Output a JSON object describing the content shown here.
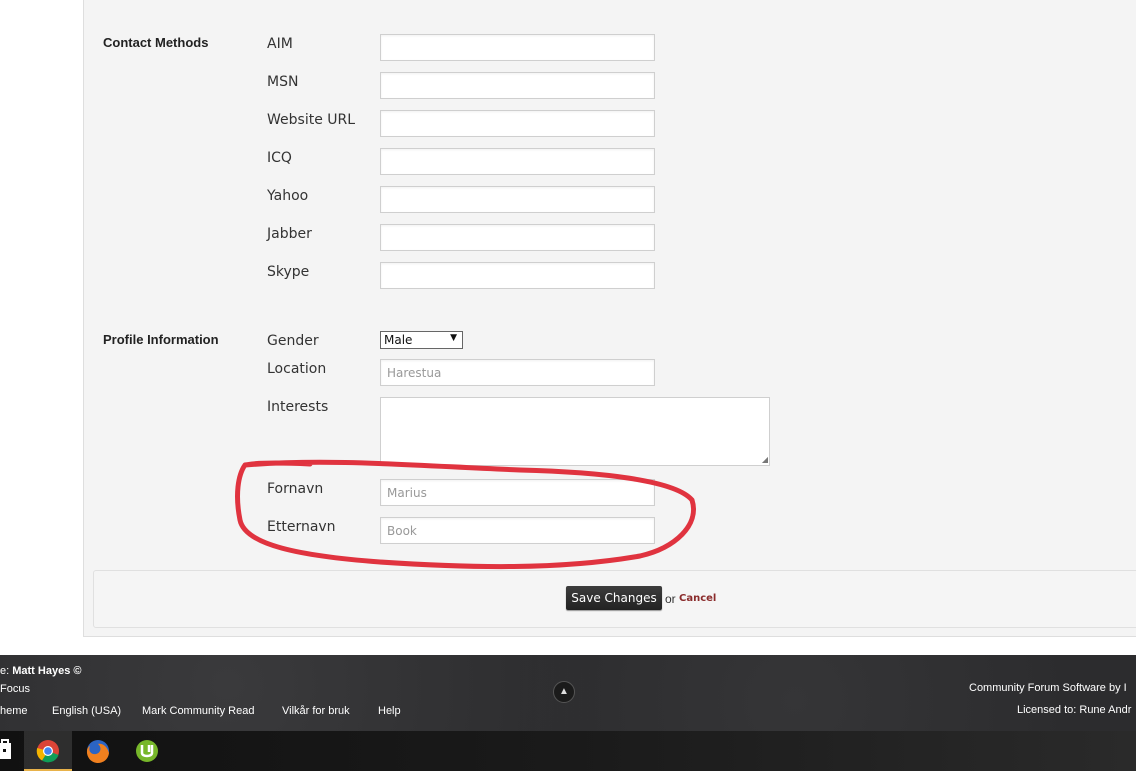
{
  "contact_methods": {
    "title": "Contact Methods",
    "fields": [
      {
        "label": "AIM",
        "value": ""
      },
      {
        "label": "MSN",
        "value": ""
      },
      {
        "label": "Website URL",
        "value": ""
      },
      {
        "label": "ICQ",
        "value": ""
      },
      {
        "label": "Yahoo",
        "value": ""
      },
      {
        "label": "Jabber",
        "value": ""
      },
      {
        "label": "Skype",
        "value": ""
      }
    ]
  },
  "profile_information": {
    "title": "Profile Information",
    "gender": {
      "label": "Gender",
      "value": "Male"
    },
    "location": {
      "label": "Location",
      "value": "Harestua"
    },
    "interests": {
      "label": "Interests",
      "value": ""
    },
    "fornavn": {
      "label": "Fornavn",
      "value": "Marius"
    },
    "etternavn": {
      "label": "Etternavn",
      "value": "Book"
    }
  },
  "actions": {
    "save_label": "Save Changes",
    "or_text": "or",
    "cancel_label": "Cancel"
  },
  "annotation": {
    "color": "#e0333f"
  },
  "footer": {
    "credit_prefix": "e: ",
    "credit_name": "Matt Hayes ©",
    "focus_text": "Focus",
    "links": [
      "heme",
      "English (USA)",
      "Mark Community Read",
      "Vilkår for bruk",
      "Help"
    ],
    "right_line1": "Community Forum Software by I",
    "right_line2": "Licensed to: Rune Andr"
  },
  "taskbar": {
    "icons": [
      "store-icon",
      "chrome-icon",
      "firefox-icon",
      "utorrent-icon"
    ]
  }
}
